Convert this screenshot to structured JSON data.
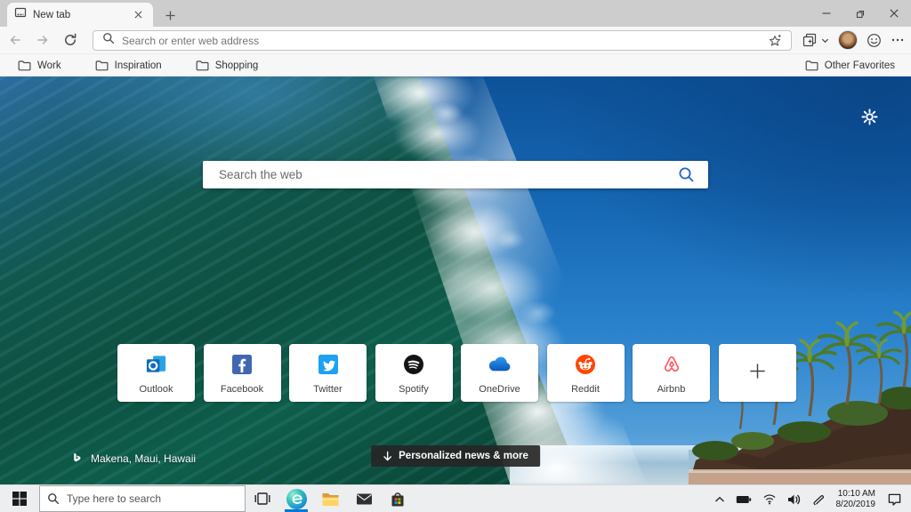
{
  "window": {
    "tab_title": "New tab"
  },
  "toolbar": {
    "address_placeholder": "Search or enter web address"
  },
  "favorites": {
    "items": [
      {
        "label": "Work"
      },
      {
        "label": "Inspiration"
      },
      {
        "label": "Shopping"
      }
    ],
    "other_label": "Other Favorites"
  },
  "page": {
    "search_placeholder": "Search the web",
    "tiles": [
      {
        "label": "Outlook"
      },
      {
        "label": "Facebook"
      },
      {
        "label": "Twitter"
      },
      {
        "label": "Spotify"
      },
      {
        "label": "OneDrive"
      },
      {
        "label": "Reddit"
      },
      {
        "label": "Airbnb"
      }
    ],
    "location_label": "Makena, Maui, Hawaii",
    "news_button_label": "Personalized news & more"
  },
  "taskbar": {
    "search_placeholder": "Type here to search",
    "time": "10:10 AM",
    "date": "8/20/2019"
  },
  "colors": {
    "accent_blue": "#0078d7",
    "search_icon_blue": "#2566c0",
    "facebook": "#4267b2",
    "twitter": "#1da1f2",
    "spotify": "#141414",
    "onedrive": "#1b86e0",
    "reddit": "#ff4500",
    "airbnb": "#ff5a5f",
    "outlook": "#0f6cbd"
  }
}
